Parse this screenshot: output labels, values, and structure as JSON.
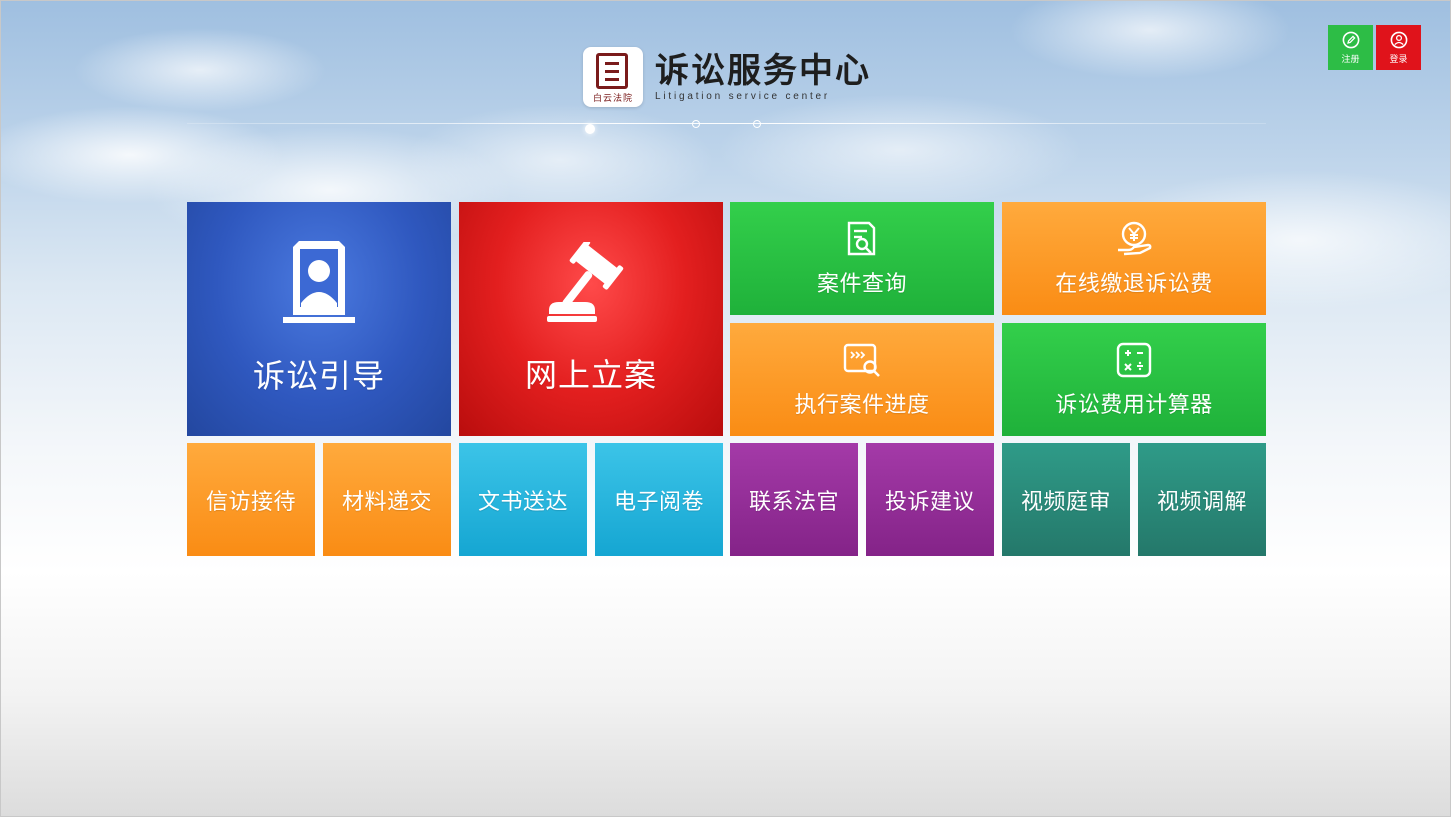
{
  "header": {
    "logo_text": "白云法院",
    "title": "诉讼服务中心",
    "subtitle": "Litigation service center"
  },
  "top_buttons": {
    "register_label": "注册",
    "login_label": "登录"
  },
  "tiles": {
    "litigation_guide": "诉讼引导",
    "online_filing": "网上立案",
    "case_query": "案件查询",
    "online_fee": "在线缴退诉讼费",
    "execution_progress": "执行案件进度",
    "fee_calculator": "诉讼费用计算器",
    "petition_reception": "信访接待",
    "material_submission": "材料递交",
    "document_delivery": "文书送达",
    "electronic_file": "电子阅卷",
    "contact_judge": "联系法官",
    "complaint_suggestion": "投诉建议",
    "video_trial": "视频庭审",
    "video_mediation": "视频调解"
  },
  "colors": {
    "blue": "#2f58bf",
    "red": "#e31f1f",
    "green": "#1fb13a",
    "orange": "#fa8c14",
    "cyan": "#15a6d2",
    "purple": "#842388",
    "teal": "#24786a"
  },
  "icons": {
    "litigation_guide": "person-frame-icon",
    "online_filing": "gavel-icon",
    "case_query": "document-search-icon",
    "online_fee": "yen-hand-icon",
    "execution_progress": "progress-search-icon",
    "fee_calculator": "calculator-icon",
    "register": "edit-icon",
    "login": "user-icon"
  }
}
